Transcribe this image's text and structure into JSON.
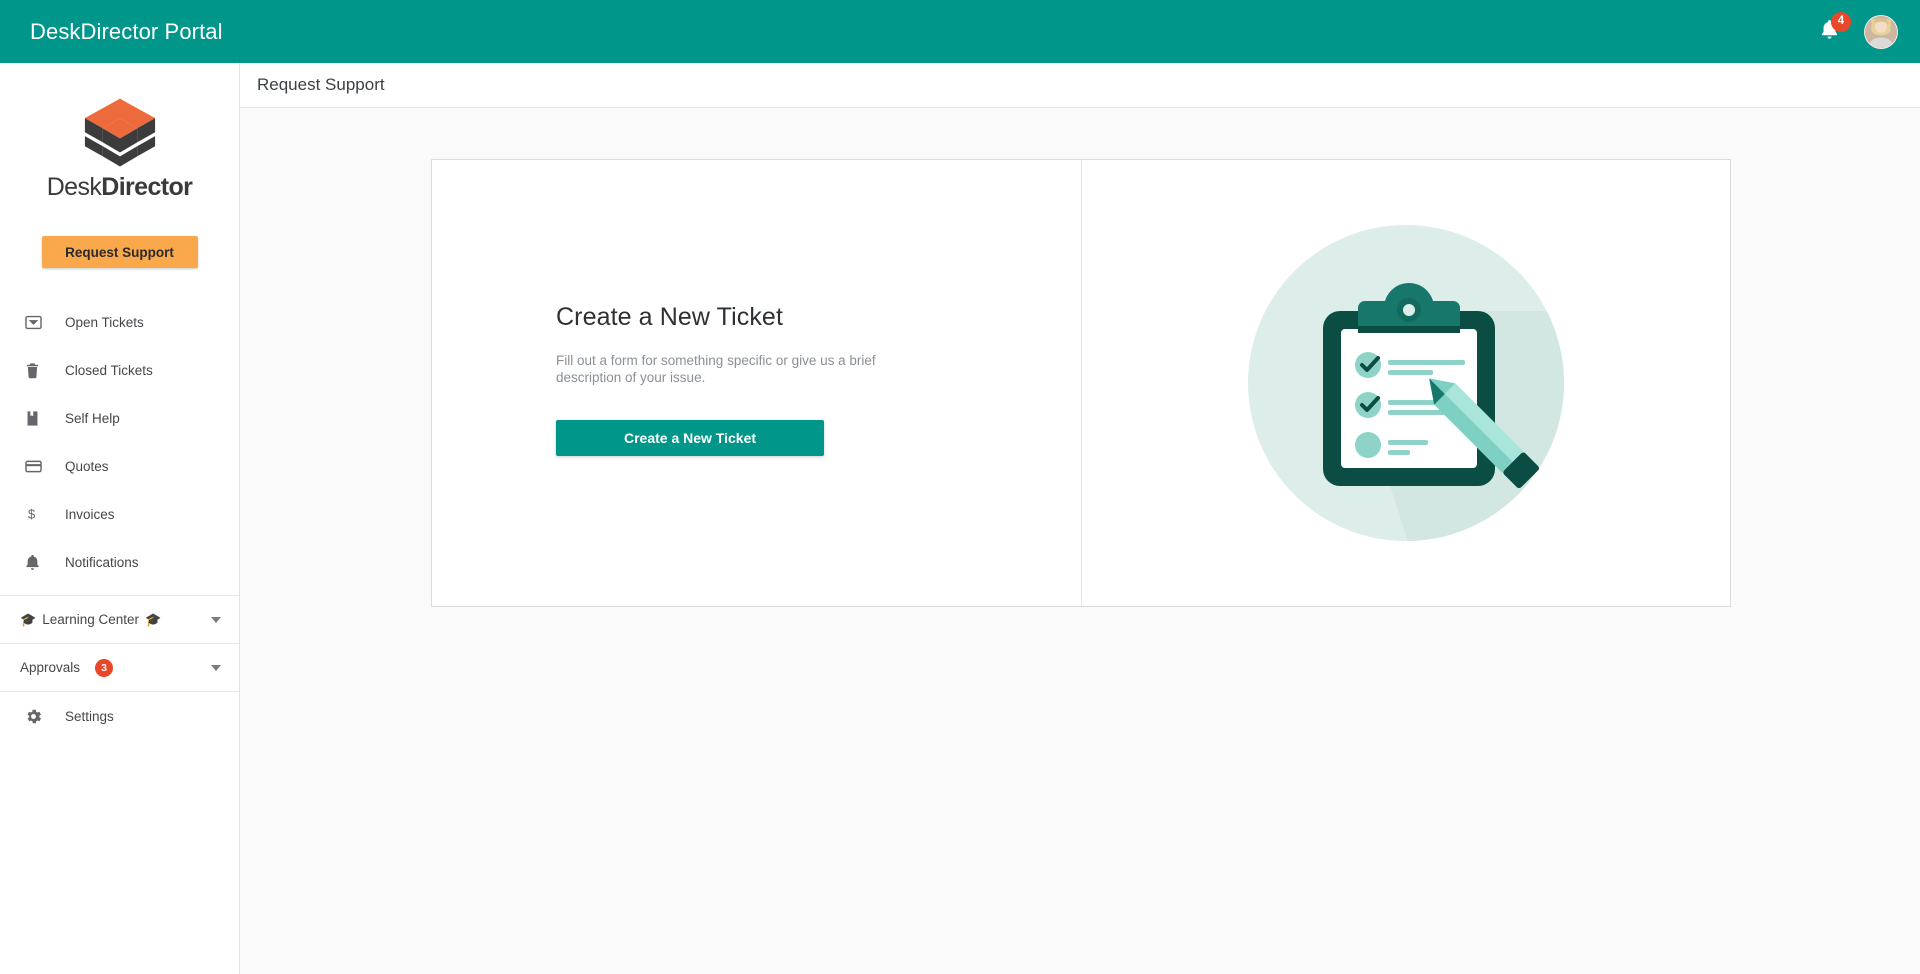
{
  "topbar": {
    "title": "DeskDirector Portal",
    "notifications_icon": "bell-icon",
    "notifications_count": "4",
    "avatar_label": "User avatar"
  },
  "sidebar": {
    "logo": {
      "icon": "deskdirector-logo-icon",
      "word_light": "Desk",
      "word_bold": "Director",
      "orange": "#ed6a3c",
      "dark": "#3c3c3c"
    },
    "request_support_button": "Request Support",
    "items": [
      {
        "label": "Open Tickets",
        "icon": "inbox-icon"
      },
      {
        "label": "Closed Tickets",
        "icon": "trash-icon"
      },
      {
        "label": "Self Help",
        "icon": "book-icon"
      },
      {
        "label": "Quotes",
        "icon": "credit-card-icon"
      },
      {
        "label": "Invoices",
        "icon": "dollar-icon"
      },
      {
        "label": "Notifications",
        "icon": "bell-icon"
      }
    ],
    "groups": [
      {
        "label": "Learning Center",
        "cap_left": "🎓",
        "cap_right": "🎓",
        "badge": "",
        "icon": "chevron-down-icon"
      },
      {
        "label": "Approvals",
        "cap_left": "",
        "cap_right": "",
        "badge": "3",
        "icon": "chevron-down-icon"
      }
    ],
    "settings": {
      "label": "Settings",
      "icon": "gear-icon"
    }
  },
  "page": {
    "title": "Request Support"
  },
  "main": {
    "headline": "Create a New Ticket",
    "subtext": "Fill out a form for something specific or give us a brief description of your issue.",
    "cta_label": "Create a New Ticket",
    "illustration": "clipboard-checklist-pencil-illustration"
  },
  "colors": {
    "brand_teal": "#00968a",
    "accent_orange": "#f9a94c",
    "badge_red": "#e8472a",
    "page_bg": "#fafafa",
    "illus_circle": "#ddedea",
    "illus_dark": "#0b4d43",
    "illus_mint": "#8fd3c8"
  }
}
